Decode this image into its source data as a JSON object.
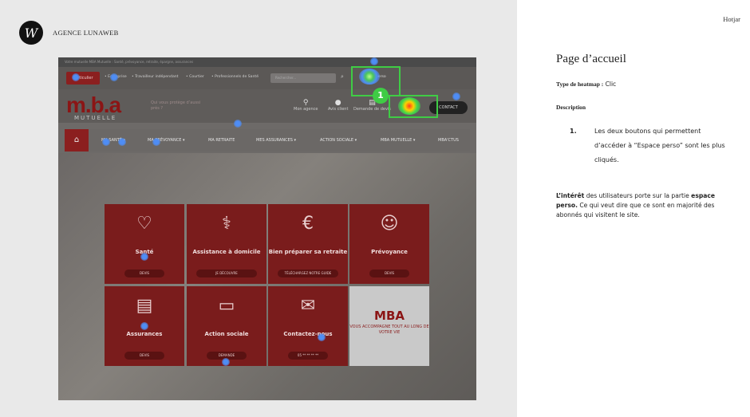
{
  "agency": {
    "logo_letters": "W",
    "name": "AGENCE LUNAWEB"
  },
  "panel": {
    "tool": "Hotjar",
    "page_title": "Page d’accueil",
    "type_label": "Type de heatmap :",
    "type_value": "Clic",
    "description_label": "Description",
    "items": [
      {
        "number": "1.",
        "text": "Les deux boutons qui permettent d’accéder à “Espace perso” sont les plus cliqués."
      }
    ],
    "interest_strong": "L’intérêt",
    "interest_text_1": " des utilisateurs porte sur la partie ",
    "interest_strong_2": "espace perso.",
    "interest_text_2": " Ce qui veut dire que ce sont en majorité des abonnés qui visitent le site."
  },
  "screenshot": {
    "top_strip": "Votre mutuelle MBA Mutuelle : Santé, prévoyance, retraite, épargne, assurances",
    "top_links": {
      "red_button": "Particulier",
      "entreprise": "• Entreprise",
      "tns": "• Travailleur indépendant",
      "courtier": "• Courtier",
      "pros": "• Professionnels de Santé"
    },
    "search_placeholder": "Rechercher...",
    "espace_label": "Espace perso",
    "logo": "m.b.a",
    "logo_sub": "MUTUELLE",
    "tagline": "Qui vous protège d’aussi près ?",
    "icons": {
      "agence": "Mon agence",
      "avis": "Avis client",
      "devis": "Demande de devis",
      "contact": "CONTACT"
    },
    "nav": [
      "MA SANTÉ ▾",
      "MA PRÉVOYANCE ▾",
      "MA RETRAITE",
      "MES ASSURANCES ▾",
      "ACTION SOCIALE ▾",
      "MBA MUTUELLE ▾",
      "MBA'CTUS"
    ],
    "tiles": [
      {
        "label": "Santé",
        "button": "DEVIS",
        "icon": "heart-pulse-icon"
      },
      {
        "label": "Assistance à domicile",
        "button": "JE DÉCOUVRE",
        "icon": "crutches-icon"
      },
      {
        "label": "Bien préparer sa retraite",
        "button": "TÉLÉCHARGEZ NOTRE GUIDE",
        "icon": "piggy-bank-icon"
      },
      {
        "label": "Prévoyance",
        "button": "DEVIS",
        "icon": "person-icon"
      },
      {
        "label": "Assurances",
        "button": "DEVIS",
        "icon": "document-icon"
      },
      {
        "label": "Action sociale",
        "button": "DEMANDE",
        "icon": "chat-icon"
      },
      {
        "label": "Contactez-nous",
        "button": "05 ** ** ** **",
        "icon": "envelope-icon"
      }
    ],
    "mba_tile": {
      "title": "MBA",
      "sub": "VOUS ACCOMPAGNE TOUT AU LONG DE VOTRE VIE"
    },
    "callout_number": "1",
    "heat_color": "#3fcc45"
  }
}
